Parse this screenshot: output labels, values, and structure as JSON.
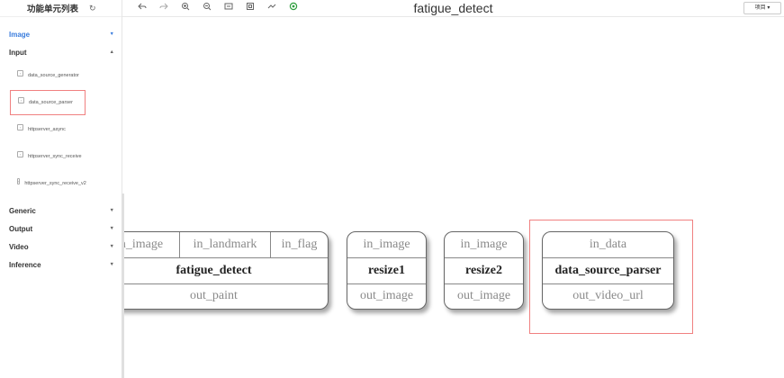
{
  "sidebar": {
    "title": "功能单元列表",
    "refresh_icon": "↻",
    "categories_top": [
      {
        "label": "Image",
        "arrow": "▼"
      },
      {
        "label": "Input",
        "arrow": "▲"
      }
    ],
    "input_items": [
      "data_source_generator",
      "data_source_parser",
      "httpserver_async",
      "httpserver_sync_receive",
      "httpserver_sync_receive_v2"
    ],
    "categories_bottom": [
      {
        "label": "Generic",
        "arrow": "▼"
      },
      {
        "label": "Output",
        "arrow": "▼"
      },
      {
        "label": "Video",
        "arrow": "▼"
      },
      {
        "label": "Inference",
        "arrow": "▼"
      }
    ]
  },
  "toolbar": {
    "title": "fatigue_detect",
    "icons": [
      "undo-icon",
      "redo-icon",
      "zoom-in-icon",
      "zoom-out-icon",
      "fit-icon",
      "fullscreen-icon",
      "layout-icon",
      "run-icon"
    ],
    "view_button": "项目 ▾"
  },
  "nodes": [
    {
      "name": "fatigue_detect",
      "inputs": [
        "in_image",
        "in_landmark",
        "in_flag"
      ],
      "output": "out_paint"
    },
    {
      "name": "resize1",
      "inputs": [
        "in_image"
      ],
      "output": "out_image"
    },
    {
      "name": "resize2",
      "inputs": [
        "in_image"
      ],
      "output": "out_image"
    },
    {
      "name": "data_source_parser",
      "inputs": [
        "in_data"
      ],
      "output": "out_video_url"
    }
  ],
  "colors": {
    "accent": "#3b7ddd",
    "selection": "#f08080",
    "run": "#2e9e3e"
  }
}
